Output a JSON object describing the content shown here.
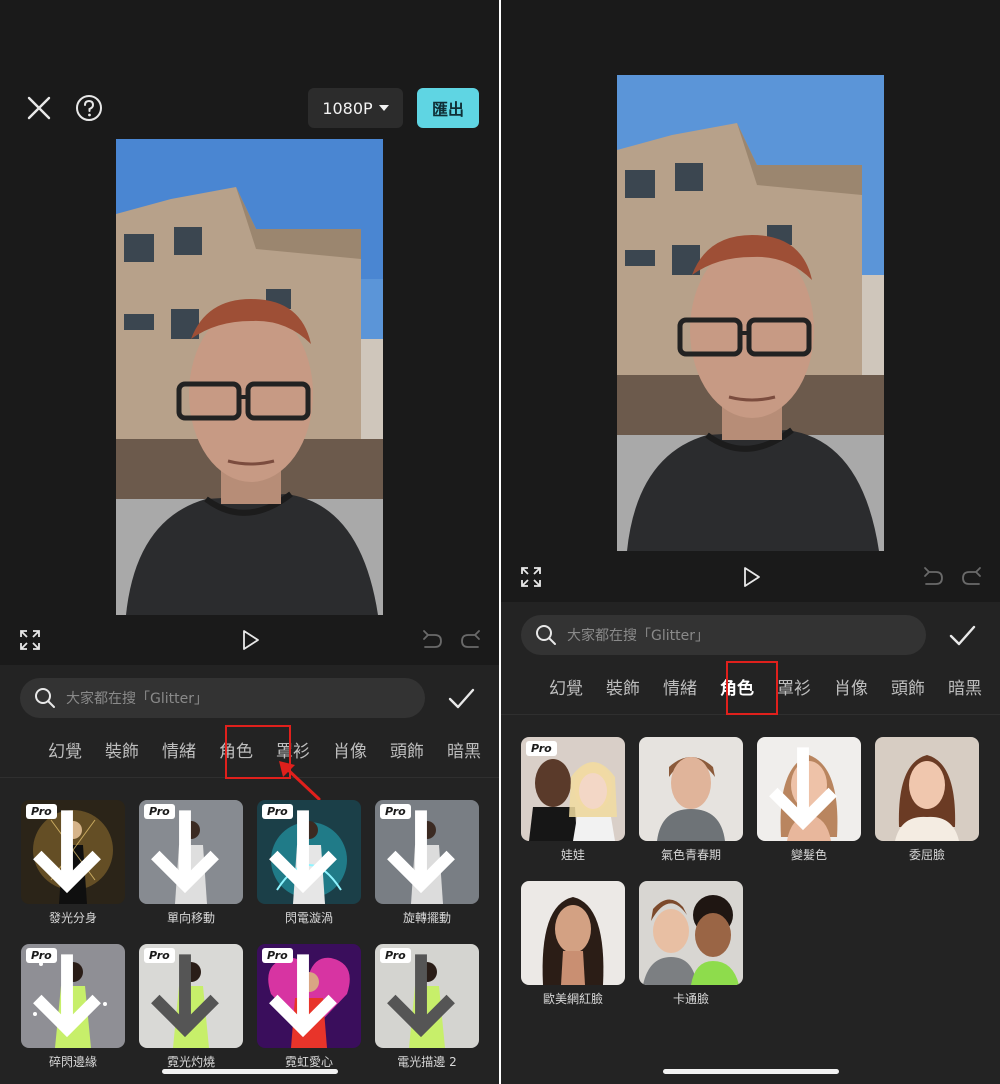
{
  "left": {
    "top_bar": {
      "resolution": "1080P",
      "export_label": "匯出",
      "close_icon": "close-icon",
      "help_icon": "help-icon"
    },
    "search": {
      "placeholder": "大家都在搜「Glitter」"
    },
    "tabs": [
      "幻覺",
      "裝飾",
      "情緒",
      "角色",
      "罩衫",
      "肖像",
      "頭飾",
      "暗黑"
    ],
    "highlighted_tab": "角色",
    "effects": [
      {
        "label": "發光分身",
        "pro": "Pro"
      },
      {
        "label": "單向移動",
        "pro": "Pro"
      },
      {
        "label": "閃電漩渦",
        "pro": "Pro"
      },
      {
        "label": "旋轉擺動",
        "pro": "Pro"
      },
      {
        "label": "碎閃邊緣",
        "pro": "Pro"
      },
      {
        "label": "霓光灼燒",
        "pro": "Pro"
      },
      {
        "label": "霓虹愛心",
        "pro": "Pro"
      },
      {
        "label": "電光描邊 2",
        "pro": "Pro"
      }
    ]
  },
  "right": {
    "search": {
      "placeholder": "大家都在搜「Glitter」"
    },
    "tabs": [
      "幻覺",
      "裝飾",
      "情緒",
      "角色",
      "罩衫",
      "肖像",
      "頭飾",
      "暗黑"
    ],
    "active_tab": "角色",
    "effects": [
      {
        "label": "娃娃",
        "pro": "Pro"
      },
      {
        "label": "氣色青春期",
        "pro": ""
      },
      {
        "label": "變髮色",
        "pro": ""
      },
      {
        "label": "委屈臉",
        "pro": ""
      },
      {
        "label": "歐美網紅臉",
        "pro": ""
      },
      {
        "label": "卡通臉",
        "pro": ""
      }
    ]
  },
  "colors": {
    "background": "#1a1a1a",
    "sheet": "#232323",
    "accent": "#5fd5e3",
    "highlight": "#e0201c"
  }
}
